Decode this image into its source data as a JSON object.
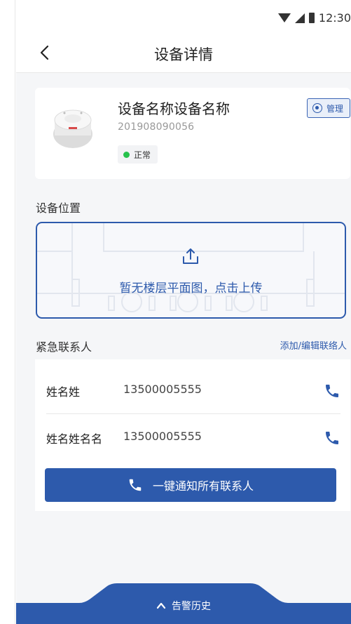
{
  "status_bar": {
    "time": "12:30"
  },
  "nav": {
    "title": "设备详情"
  },
  "device": {
    "name": "设备名称设备名称",
    "id": "201908090056",
    "status": "正常",
    "manage_label": "管理"
  },
  "location": {
    "title": "设备位置",
    "upload_text": "暂无楼层平面图，点击上传"
  },
  "contacts": {
    "title": "紧急联系人",
    "add_link": "添加/编辑联络人",
    "items": [
      {
        "name": "姓名姓",
        "phone": "13500005555"
      },
      {
        "name": "姓名姓名名",
        "phone": "13500005555"
      }
    ],
    "notify_button": "一键通知所有联系人"
  },
  "history": {
    "label": "告警历史"
  },
  "colors": {
    "primary": "#2d5aac",
    "status_ok": "#27c24c",
    "background": "#f5f6f8"
  },
  "icons": [
    "back-arrow-icon",
    "wifi-icon",
    "signal-icon",
    "battery-icon",
    "manage-icon",
    "upload-icon",
    "phone-icon",
    "chevron-up-icon"
  ]
}
